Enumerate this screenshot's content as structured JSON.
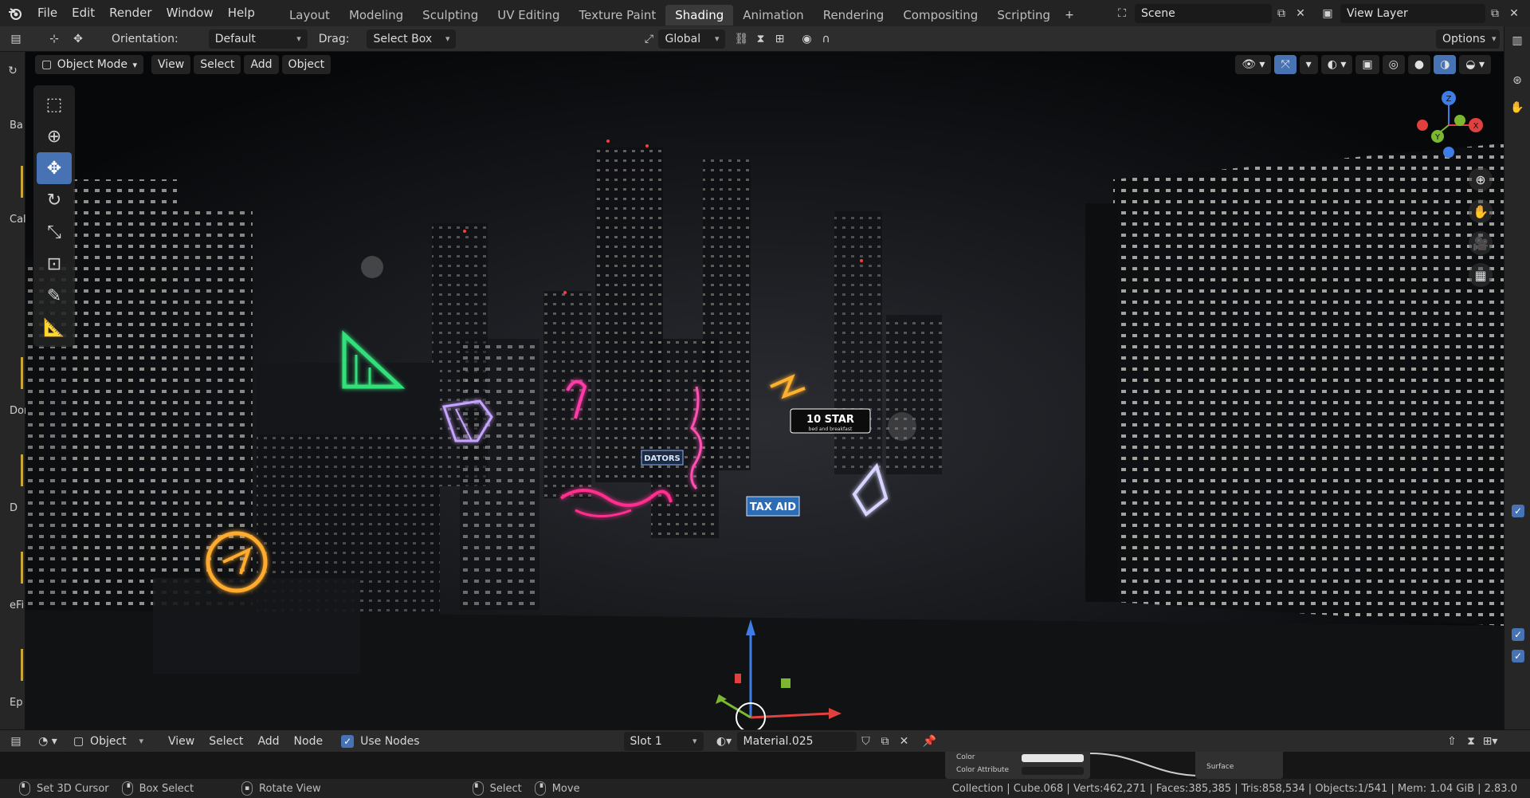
{
  "topbar": {
    "menus": [
      "File",
      "Edit",
      "Render",
      "Window",
      "Help"
    ],
    "workspaces": [
      "Layout",
      "Modeling",
      "Sculpting",
      "UV Editing",
      "Texture Paint",
      "Shading",
      "Animation",
      "Rendering",
      "Compositing",
      "Scripting"
    ],
    "active_workspace": "Shading",
    "add_workspace": "+",
    "scene": "Scene",
    "view_layer": "View Layer"
  },
  "toolsettings": {
    "orientation_label": "Orientation:",
    "orientation_value": "Default",
    "drag_label": "Drag:",
    "drag_value": "Select Box",
    "transform_space": "Global",
    "options": "Options"
  },
  "viewport": {
    "mode": "Object Mode",
    "menus": [
      "View",
      "Select",
      "Add",
      "Object"
    ],
    "axes": {
      "x": "X",
      "y": "Y",
      "z": "Z"
    },
    "signs": {
      "ten_star": "10 STAR",
      "ten_star_sub": "bed and breakfast",
      "tax_aid": "TAX AID",
      "dators": "DATORS"
    }
  },
  "left_strip_labels": [
    "Ba",
    "Cal",
    "Dor",
    "D",
    "eFi",
    "Ep"
  ],
  "node_header": {
    "editor_type": "Object",
    "menus": [
      "View",
      "Select",
      "Add",
      "Node"
    ],
    "use_nodes": "Use Nodes",
    "slot": "Slot 1",
    "material": "Material.025",
    "node_sockets": [
      "Color",
      "Color Attribute",
      "Surface"
    ]
  },
  "statusbar": {
    "hints": [
      "Set 3D Cursor",
      "Box Select",
      "Rotate View",
      "Select",
      "Move"
    ],
    "stats": "Collection | Cube.068 | Verts:462,271 | Faces:385,385 | Tris:858,534 | Objects:1/541 | Mem: 1.04 GiB | 2.83.0"
  },
  "colors": {
    "accent": "#4772b3",
    "x_axis": "#e0413f",
    "y_axis": "#7cb732",
    "z_axis": "#3e7ce6"
  }
}
